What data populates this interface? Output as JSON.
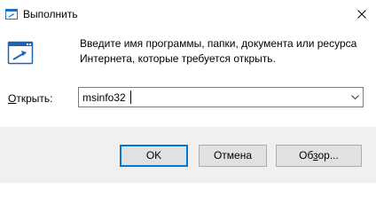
{
  "window": {
    "title": "Выполнить",
    "title_icon": "run-icon",
    "close_icon": "close-icon"
  },
  "main": {
    "icon": "run-program-icon",
    "description_line1": "Введите имя программы, папки, документа или ресурса",
    "description_line2": "Интернета, которые требуется открыть.",
    "open_label_accel": "О",
    "open_label_rest": "ткрыть:",
    "input_value": "msinfo32",
    "dropdown_icon": "chevron-down-icon"
  },
  "buttons": {
    "ok": "OK",
    "cancel": "Отмена",
    "browse_pre": "Об",
    "browse_accel": "з",
    "browse_post": "ор..."
  },
  "colors": {
    "accent": "#0078d7",
    "footer_bg": "#f0f0f0",
    "button_bg": "#e1e1e1"
  }
}
